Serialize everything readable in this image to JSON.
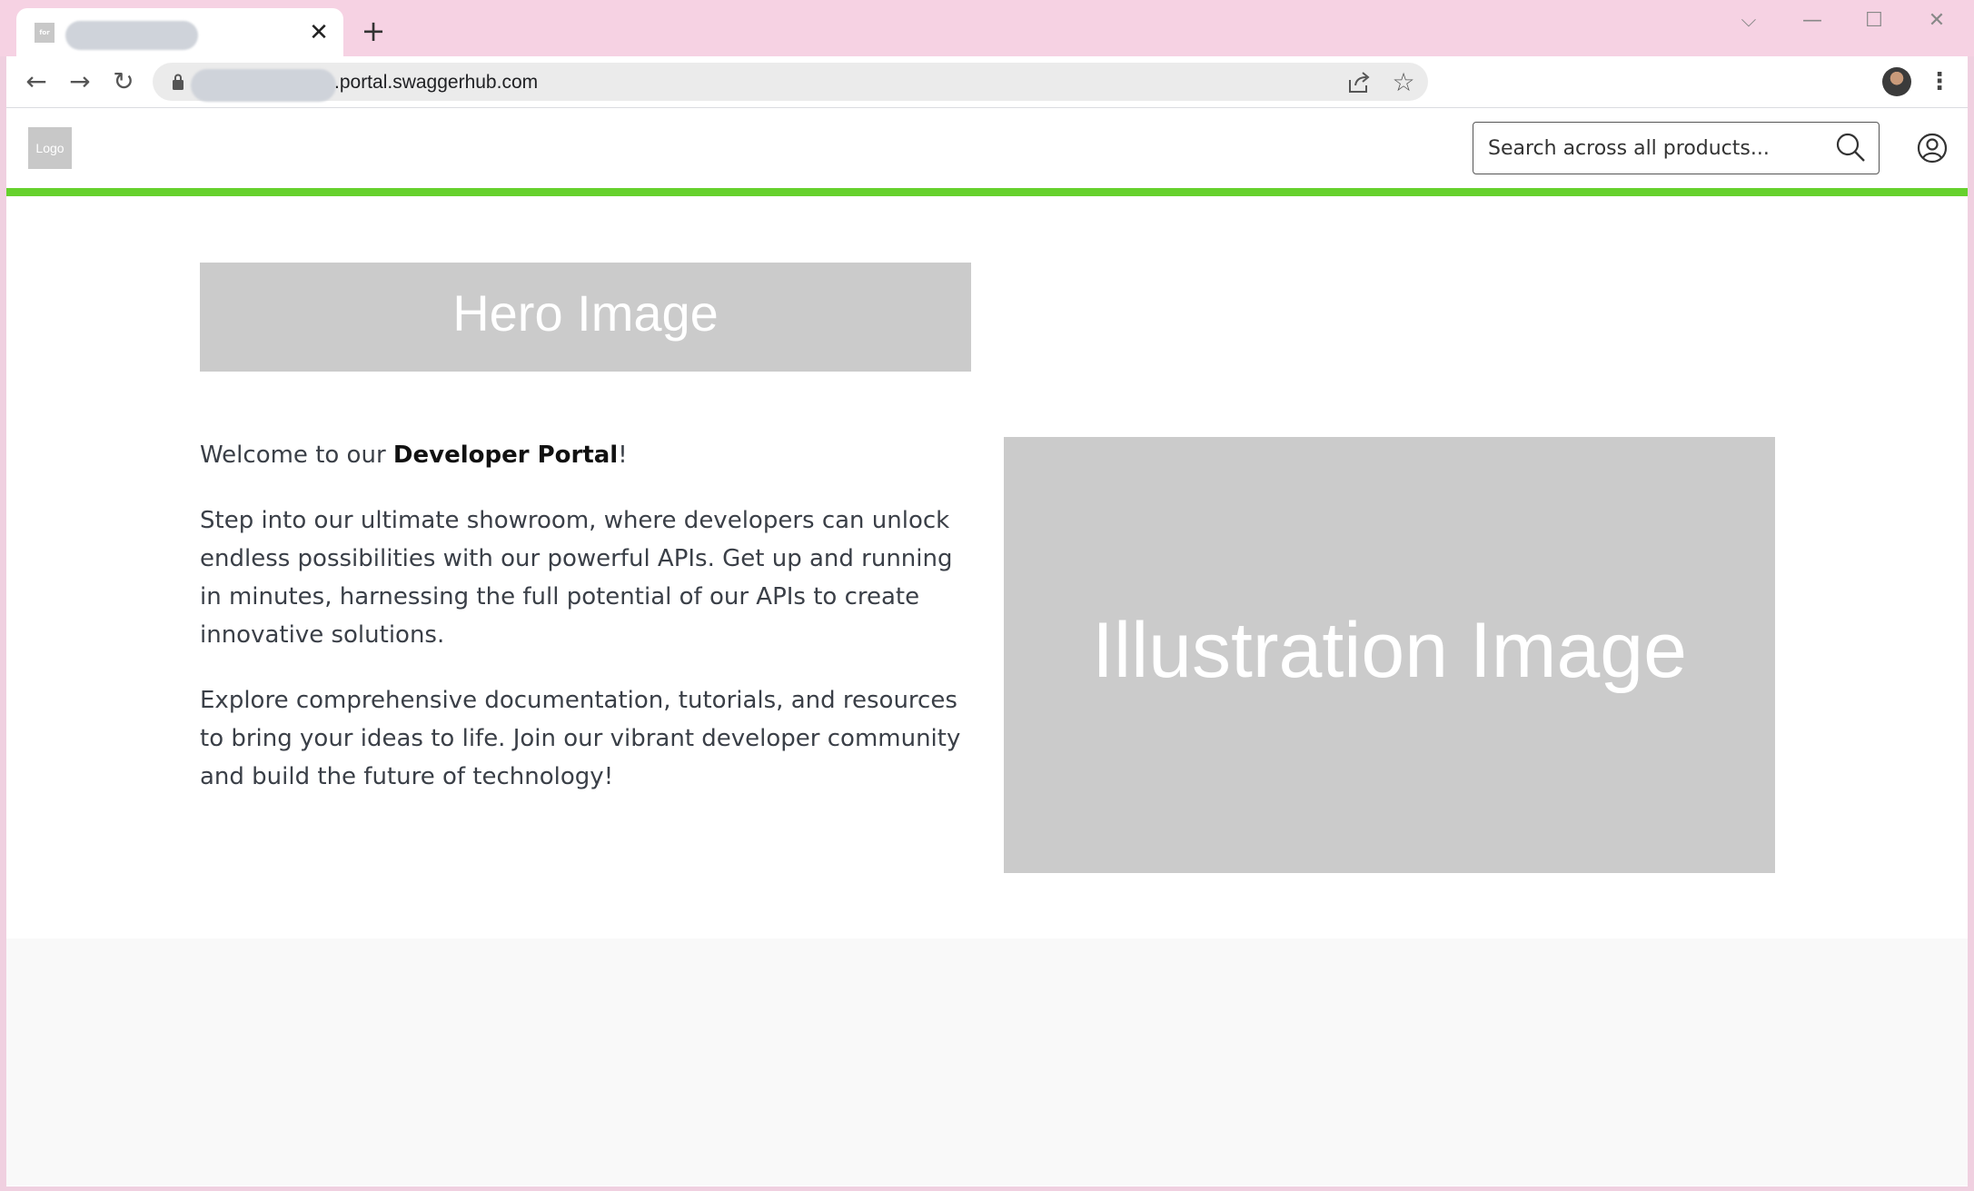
{
  "browser": {
    "tab": {
      "favicon_text": "for",
      "close_glyph": "✕"
    },
    "new_tab_glyph": "+",
    "window_controls": {
      "dropdown": "⌵",
      "minimize": "—",
      "maximize": "☐",
      "close": "✕"
    },
    "url": ".portal.swaggerhub.com",
    "nav": {
      "back": "←",
      "forward": "→",
      "reload": "↻"
    },
    "star_glyph": "☆",
    "menu_glyph": "⋮"
  },
  "header": {
    "logo_text": "Logo",
    "search": {
      "placeholder": "Search across all products..."
    },
    "accent_color": "#66d12d"
  },
  "main": {
    "hero_text": "Hero Image",
    "welcome": {
      "prefix": "Welcome to our ",
      "bold": "Developer Portal",
      "suffix": "!"
    },
    "paragraph1": "Step into our ultimate showroom, where developers can unlock endless possibilities with our powerful APIs. Get up and running in minutes, harnessing the full potential of our APIs to create innovative solutions.",
    "paragraph2": "Explore comprehensive documentation, tutorials, and resources to bring your ideas to life. Join our vibrant developer community and build the future of technology!",
    "illustration_text": "Illustration Image"
  },
  "icons": [
    "lock-icon",
    "share-icon",
    "star-icon",
    "search-icon",
    "account-icon",
    "menu-dots-icon"
  ]
}
